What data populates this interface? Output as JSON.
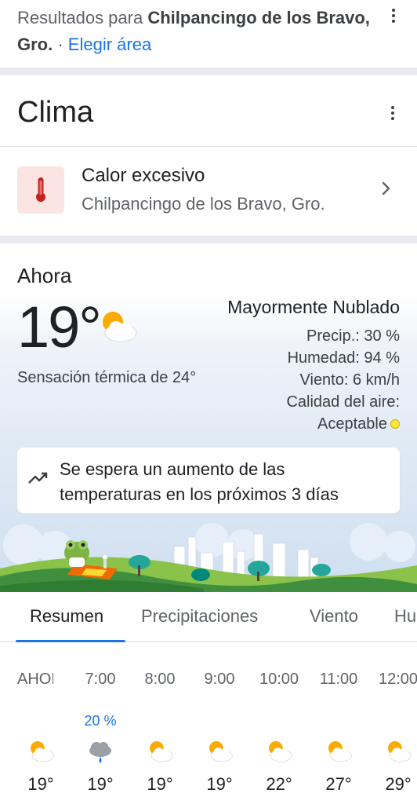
{
  "results": {
    "prefix": "Resultados para ",
    "place": "Chilpancingo de los Bravo, Gro.",
    "separator": " · ",
    "change_area": "Elegir área"
  },
  "clima": {
    "title": "Clima",
    "alert": {
      "title": "Calor excesivo",
      "location": "Chilpancingo de los Bravo, Gro.",
      "icon": "thermometer-icon"
    }
  },
  "current": {
    "label": "Ahora",
    "temperature": "19°",
    "icon": "partly-cloudy-icon",
    "feels_like": "Sensación térmica de 24°",
    "condition": "Mayormente Nublado",
    "precip": "Precip.: 30 %",
    "humidity": "Humedad: 94 %",
    "wind": "Viento: 6 km/h",
    "air_quality_label": "Calidad del aire:",
    "air_quality_value": "Aceptable",
    "air_quality_color": "#fbe83a"
  },
  "trend": {
    "icon": "trending-up-icon",
    "text": "Se espera un aumento de las temperaturas en los próximos 3 días"
  },
  "tabs": [
    {
      "label": "Resumen",
      "active": true
    },
    {
      "label": "Precipitaciones",
      "active": false
    },
    {
      "label": "Viento",
      "active": false
    },
    {
      "label": "Hu",
      "active": false
    }
  ],
  "hourly": [
    {
      "time": "AHORA",
      "precip": "",
      "icon": "partly-cloudy-icon",
      "temp": "19°"
    },
    {
      "time": "7:00",
      "precip": "20 %",
      "icon": "rain-cloud-icon",
      "temp": "19°"
    },
    {
      "time": "8:00",
      "precip": "",
      "icon": "partly-cloudy-icon",
      "temp": "19°"
    },
    {
      "time": "9:00",
      "precip": "",
      "icon": "partly-cloudy-icon",
      "temp": "19°"
    },
    {
      "time": "10:00",
      "precip": "",
      "icon": "partly-cloudy-icon",
      "temp": "22°"
    },
    {
      "time": "11:00",
      "precip": "",
      "icon": "partly-cloudy-icon",
      "temp": "27°"
    },
    {
      "time": "12:00",
      "precip": "",
      "icon": "partly-cloudy-icon",
      "temp": "29°"
    }
  ],
  "colors": {
    "accent": "#1a73e8",
    "alert_bg": "#fce4e2",
    "alert_icon": "#c5221f"
  }
}
